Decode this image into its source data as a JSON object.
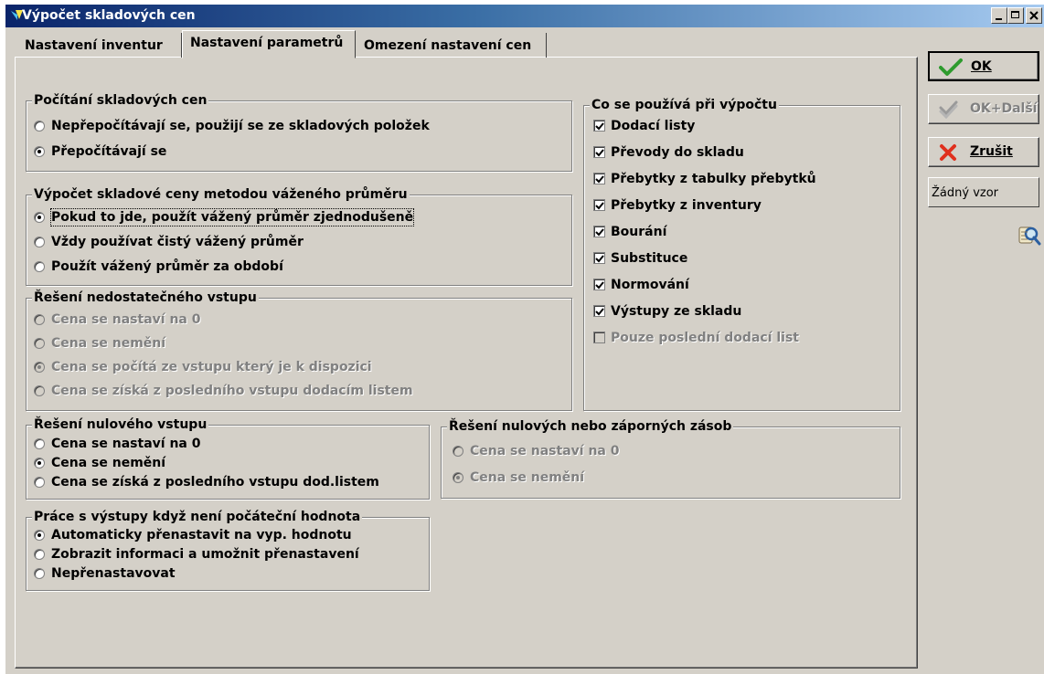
{
  "window": {
    "title": "Výpočet skladových cen"
  },
  "tabs": [
    {
      "label": "Nastavení inventur"
    },
    {
      "label": "Nastavení parametrů",
      "active": true
    },
    {
      "label": "Omezení nastavení cen"
    }
  ],
  "groups": {
    "pocitani": {
      "title": "Počítání skladových cen",
      "options": [
        {
          "label": "Nepřepočítávají se, použijí se ze skladových položek",
          "checked": false
        },
        {
          "label": "Přepočítávají se",
          "checked": true
        }
      ]
    },
    "vazeny": {
      "title": "Výpočet skladové ceny metodou váženého průměru",
      "options": [
        {
          "label": "Pokud to jde, použít vážený průměr zjednodušeně",
          "checked": true
        },
        {
          "label": "Vždy používat čistý vážený průměr",
          "checked": false
        },
        {
          "label": "Použít vážený průměr za období",
          "checked": false
        }
      ]
    },
    "nedostatecny": {
      "title": "Řešení nedostatečného vstupu",
      "disabled": true,
      "options": [
        {
          "label": "Cena se nastaví na 0",
          "checked": false
        },
        {
          "label": "Cena se nemění",
          "checked": false
        },
        {
          "label": "Cena se počítá ze vstupu který je k dispozici",
          "checked": true
        },
        {
          "label": "Cena se získá z posledního vstupu dodacím listem",
          "checked": false
        }
      ]
    },
    "nulovy": {
      "title": "Řešení nulového vstupu",
      "options": [
        {
          "label": "Cena se nastaví na 0",
          "checked": false
        },
        {
          "label": "Cena se nemění",
          "checked": true
        },
        {
          "label": "Cena se získá z posledního vstupu dod.listem",
          "checked": false
        }
      ]
    },
    "zaporne": {
      "title": "Řešení nulových nebo záporných zásob",
      "disabled": true,
      "options": [
        {
          "label": "Cena se nastaví na 0",
          "checked": false
        },
        {
          "label": "Cena se nemění",
          "checked": true
        }
      ]
    },
    "vystupy": {
      "title": "Práce s výstupy když není počáteční hodnota",
      "options": [
        {
          "label": "Automaticky přenastavit na vyp. hodnotu",
          "checked": true
        },
        {
          "label": "Zobrazit informaci a umožnit přenastavení",
          "checked": false
        },
        {
          "label": "Nepřenastavovat",
          "checked": false
        }
      ]
    },
    "pouziva": {
      "title": "Co se používá při výpočtu",
      "items": [
        {
          "label": "Dodací listy",
          "checked": true
        },
        {
          "label": "Převody do skladu",
          "checked": true
        },
        {
          "label": "Přebytky z tabulky přebytků",
          "checked": true
        },
        {
          "label": "Přebytky z inventury",
          "checked": true
        },
        {
          "label": "Bourání",
          "checked": true
        },
        {
          "label": "Substituce",
          "checked": true
        },
        {
          "label": "Normování",
          "checked": true
        },
        {
          "label": "Výstupy ze skladu",
          "checked": true
        },
        {
          "label": "Pouze poslední dodací list",
          "checked": false,
          "disabled": true
        }
      ]
    }
  },
  "buttons": {
    "ok": "OK",
    "ok_dalsi": "OK+Další",
    "zrusit": "Zrušit"
  },
  "vzor": "Žádný vzor",
  "colors": {
    "face": "#d4d0c8",
    "title_start": "#0a246a",
    "title_end": "#a6caf0",
    "ok_check": "#2e9b2e",
    "cancel_x": "#e0301e"
  }
}
